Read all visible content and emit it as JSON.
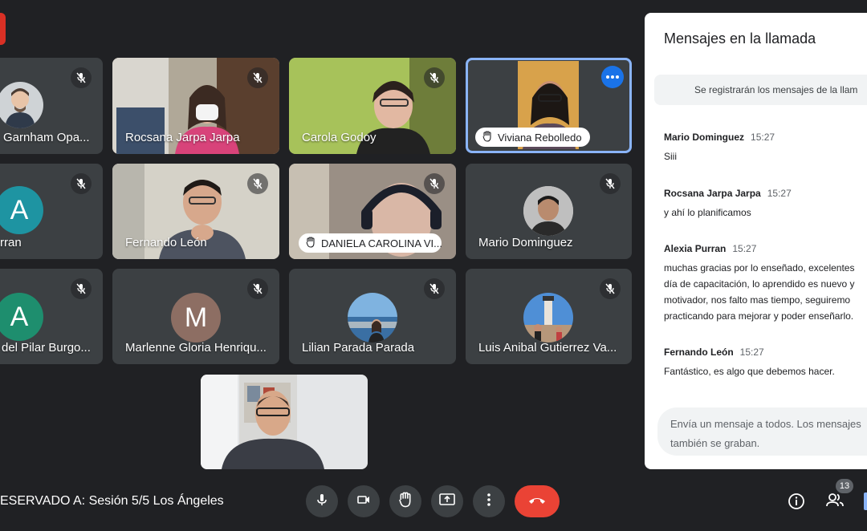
{
  "participants": [
    {
      "name": "Garnham Opa..."
    },
    {
      "name": "Rocsana Jarpa Jarpa"
    },
    {
      "name": "Carola Godoy"
    },
    {
      "name": "Viviana Rebolledo"
    },
    {
      "name": "rran",
      "initial": "A"
    },
    {
      "name": "Fernando León"
    },
    {
      "name": "DANIELA CAROLINA VI..."
    },
    {
      "name": "Mario Dominguez"
    },
    {
      "name": "del Pilar Burgo...",
      "initial": "A"
    },
    {
      "name": "Marlenne Gloria Henriqu...",
      "initial": "M"
    },
    {
      "name": "Lilian Parada Parada"
    },
    {
      "name": "Luis Anibal Gutierrez Va..."
    }
  ],
  "chat": {
    "title": "Mensajes en la llamada",
    "notice": "Se registrarán los mensajes de la llam",
    "messages": [
      {
        "sender": "Mario Dominguez",
        "time": "15:27",
        "text": "Siii"
      },
      {
        "sender": "Rocsana Jarpa Jarpa",
        "time": "15:27",
        "text": "y  ahí lo planificamos"
      },
      {
        "sender": "Alexia Purran",
        "time": "15:27",
        "text": "muchas gracias por lo enseñado, excelentes\ndía de capacitación, lo aprendido es nuevo y\nmotivador, nos falto mas tiempo, seguiremo\npracticando para mejorar y poder enseñarlo."
      },
      {
        "sender": "Fernando León",
        "time": "15:27",
        "text": "Fantástico, es algo que debemos hacer."
      }
    ],
    "composer_placeholder": "Envía un mensaje a todos. Los mensajes también se graban."
  },
  "meeting": {
    "title": "ESERVADO A: Sesión 5/5 Los Ángeles"
  },
  "people_count": "13",
  "colors": {
    "background": "#202124",
    "tile": "#3c4043",
    "accent": "#1a73e8",
    "end_call": "#ea4335",
    "active_border": "#8ab4f8"
  }
}
